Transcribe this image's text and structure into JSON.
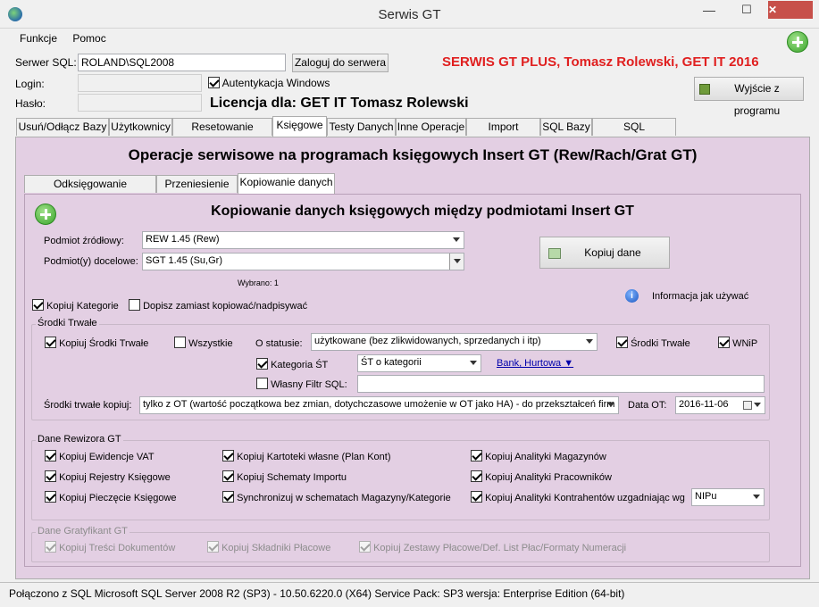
{
  "window": {
    "title": "Serwis GT",
    "minimize": "—",
    "maximize": "☐",
    "close": "✕"
  },
  "menu": [
    "Funkcje",
    "Pomoc"
  ],
  "server": {
    "label": "Serwer SQL:",
    "value": "ROLAND\\SQL2008",
    "login_btn": "Zaloguj do serwera",
    "login_label": "Login:",
    "pass_label": "Hasło:",
    "win_auth": "Autentykacja Windows",
    "win_auth_checked": true,
    "license": "Licencja dla: GET IT Tomasz Rolewski"
  },
  "brand": {
    "text": "SERWIS GT PLUS, Tomasz Rolewski, GET IT 2016",
    "color": "#e02020"
  },
  "exit_btn": "Wyjście z programu",
  "main_tabs": [
    "Usuń/Odłącz Bazy",
    "Użytkownicy",
    "Resetowanie Licencji",
    "Księgowe",
    "Testy Danych",
    "Inne Operacje",
    "Import Kartotek",
    "SQL Bazy",
    "SQL Użytkownicy"
  ],
  "main_heading": "Operacje serwisowe na programach księgowych  Insert GT (Rew/Rach/Grat GT)",
  "sub_tabs": [
    "Odksięgowanie dokumentów",
    "Przeniesienie BO",
    "Kopiowanie danych"
  ],
  "copy": {
    "heading": "Kopiowanie danych księgowych między podmiotami Insert GT",
    "source_label": "Podmiot źródłowy:",
    "source_value": "REW 1.45 (Rew)",
    "target_label": "Podmiot(y) docelowe:",
    "target_value": "SGT 1.45 (Su,Gr)",
    "selected": "Wybrano: 1",
    "copy_btn": "Kopiuj dane",
    "info": "Informacja jak używać",
    "copy_categories": "Kopiuj Kategorie",
    "append": "Dopisz zamiast kopiować/nadpisywać"
  },
  "fixed_assets": {
    "legend": "Środki Trwałe",
    "copy": "Kopiuj Środki Trwałe",
    "all": "Wszystkie",
    "status_label": "O statusie:",
    "status_value": "użytkowane (bez zlikwidowanych, sprzedanych i itp)",
    "st": "Środki Trwałe",
    "wnip": "WNiP",
    "category_label": "Kategoria ŚT",
    "category_value": "ŚT o kategorii",
    "category_link": "Bank, Hurtowa ▼",
    "own_filter": "Własny Filtr SQL:",
    "copy_mode_label": "Środki trwałe kopiuj:",
    "copy_mode_value": "tylko z OT (wartość początkowa bez zmian, dotychczasowe umożenie w OT jako HA) - do przekształceń firm",
    "date_label": "Data OT:",
    "date_value": "2016-11-06"
  },
  "rewizor": {
    "legend": "Dane Rewizora GT",
    "items": [
      "Kopiuj Ewidencje VAT",
      "Kopiuj Rejestry Księgowe",
      "Kopiuj Pieczęcie Księgowe",
      "Kopiuj Kartoteki własne (Plan Kont)",
      "Kopiuj Schematy Importu",
      "Synchronizuj w schematach Magazyny/Kategorie",
      "Kopiuj Analityki Magazynów",
      "Kopiuj Analityki Pracowników",
      "Kopiuj Analityki Kontrahentów uzgadniając wg"
    ],
    "match_value": "NIPu"
  },
  "gratyfikant": {
    "legend": "Dane Gratyfikant GT",
    "items": [
      "Kopiuj Treści Dokumentów",
      "Kopiuj Składniki Płacowe",
      "Kopiuj Zestawy Płacowe/Def. List Płac/Formaty Numeracji"
    ]
  },
  "status_bar": "Połączono z SQL  Microsoft SQL Server 2008 R2 (SP3) - 10.50.6220.0 (X64)  Service Pack: SP3  wersja: Enterprise Edition (64-bit)"
}
